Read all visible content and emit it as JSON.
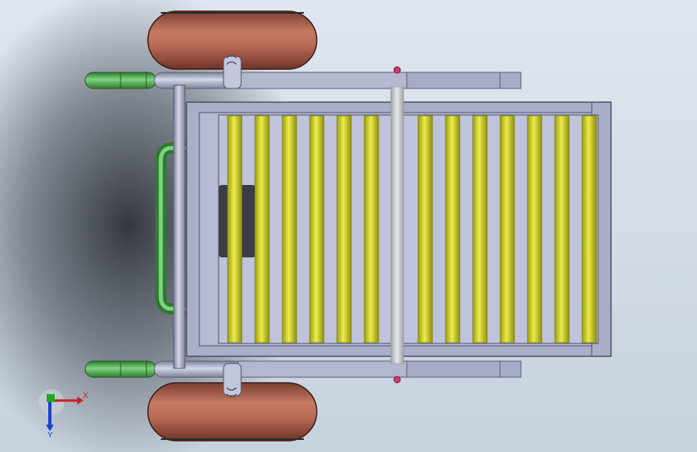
{
  "viewport": {
    "background_top": "#dfe6ef",
    "background_bottom": "#c7d2df",
    "shadow_color": "#2b2f35"
  },
  "model": {
    "colors": {
      "frame": "#a9aec9",
      "frame_dark": "#6b7088",
      "roller": "#d6d62b",
      "roller_dark": "#9a9a12",
      "center_rod": "#cfd2d6",
      "wheel": "#b96a55",
      "wheel_dark": "#7a3e30",
      "grip": "#5ab85a",
      "grip_dark": "#2f7a30",
      "fastener": "#d23a6a"
    },
    "roller_count": 13
  },
  "triad": {
    "x_label": "X",
    "y_label": "Y",
    "x_color": "#cc2020",
    "y_color": "#1a40cc",
    "z_color": "#20aa20"
  }
}
